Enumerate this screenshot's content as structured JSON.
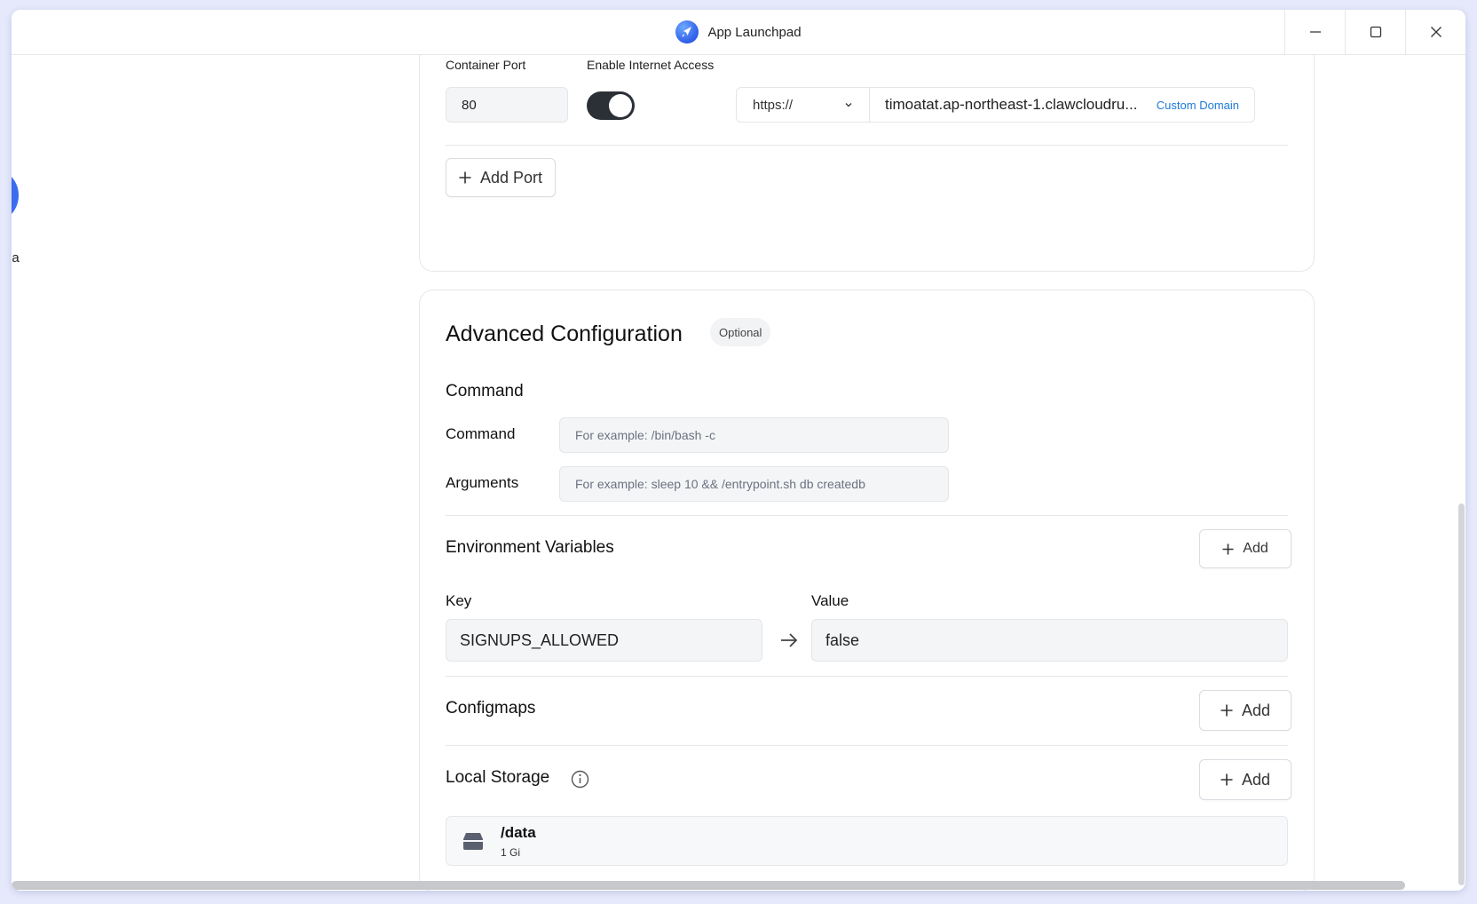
{
  "window": {
    "title": "App Launchpad"
  },
  "sidebar": {
    "partial_label": "pa"
  },
  "network": {
    "container_port_label": "Container Port",
    "container_port_value": "80",
    "internet_access_label": "Enable Internet Access",
    "internet_access_enabled": true,
    "protocol": "https://",
    "domain": "timoatat.ap-northeast-1.clawcloudru...",
    "custom_domain_label": "Custom Domain",
    "add_port_label": "Add Port"
  },
  "advanced": {
    "title": "Advanced Configuration",
    "badge": "Optional",
    "command_section": "Command",
    "command_label": "Command",
    "command_placeholder": "For example:  /bin/bash -c",
    "arguments_label": "Arguments",
    "arguments_placeholder": "For example:  sleep 10 && /entrypoint.sh db createdb",
    "env_title": "Environment Variables",
    "env_add": "Add",
    "key_label": "Key",
    "value_label": "Value",
    "env_key": "SIGNUPS_ALLOWED",
    "env_value": "false",
    "configmaps_title": "Configmaps",
    "configmaps_add": "Add",
    "storage_title": "Local Storage",
    "storage_add": "Add",
    "storage_path": "/data",
    "storage_size": "1 Gi"
  },
  "colors": {
    "accent": "#3b6cf0",
    "link": "#1d7ad9",
    "toggle_on": "#2b2f36"
  }
}
